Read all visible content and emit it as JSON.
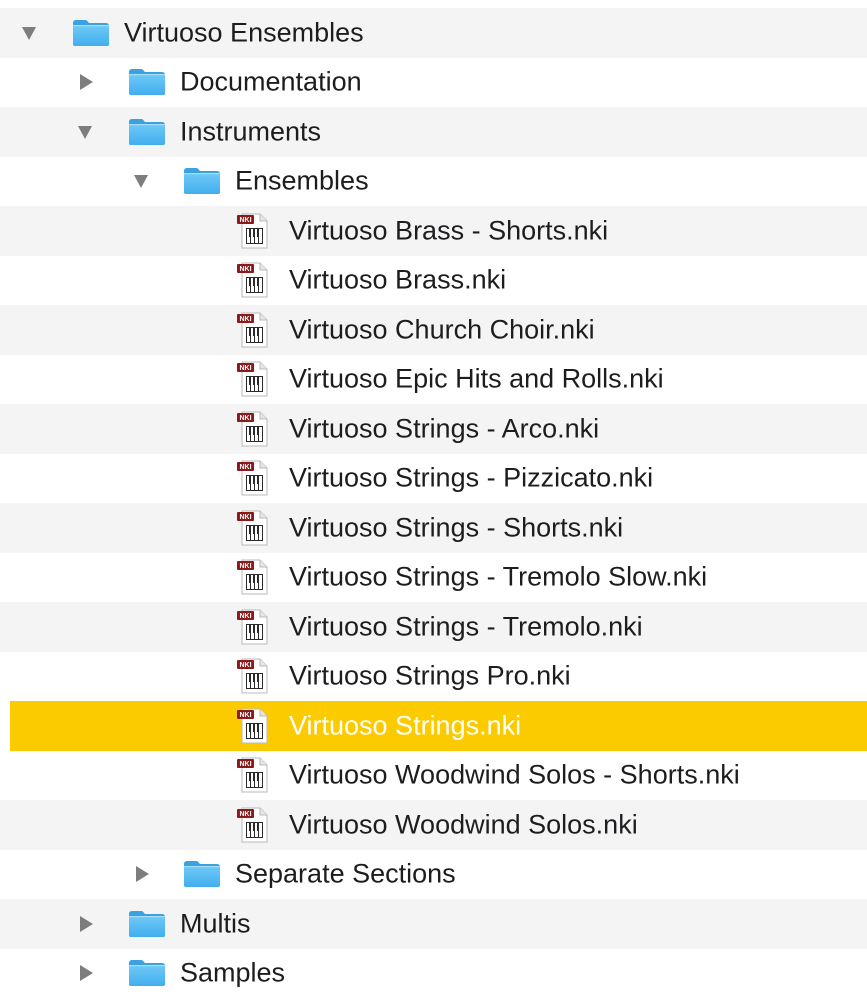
{
  "tree": {
    "root": {
      "label": "Virtuoso Ensembles",
      "icon": "folder-icon",
      "expanded": true
    },
    "documentation": {
      "label": "Documentation",
      "icon": "folder-icon",
      "expanded": false
    },
    "instruments": {
      "label": "Instruments",
      "icon": "folder-icon",
      "expanded": true
    },
    "ensembles": {
      "label": "Ensembles",
      "icon": "folder-icon",
      "expanded": true
    },
    "files": [
      {
        "label": "Virtuoso Brass - Shorts.nki",
        "icon": "nki-file-icon",
        "badge": "NKI"
      },
      {
        "label": "Virtuoso Brass.nki",
        "icon": "nki-file-icon",
        "badge": "NKI"
      },
      {
        "label": "Virtuoso Church Choir.nki",
        "icon": "nki-file-icon",
        "badge": "NKI"
      },
      {
        "label": "Virtuoso Epic Hits and Rolls.nki",
        "icon": "nki-file-icon",
        "badge": "NKI"
      },
      {
        "label": "Virtuoso Strings - Arco.nki",
        "icon": "nki-file-icon",
        "badge": "NKI"
      },
      {
        "label": "Virtuoso Strings - Pizzicato.nki",
        "icon": "nki-file-icon",
        "badge": "NKI"
      },
      {
        "label": "Virtuoso Strings - Shorts.nki",
        "icon": "nki-file-icon",
        "badge": "NKI"
      },
      {
        "label": "Virtuoso Strings - Tremolo Slow.nki",
        "icon": "nki-file-icon",
        "badge": "NKI"
      },
      {
        "label": "Virtuoso Strings - Tremolo.nki",
        "icon": "nki-file-icon",
        "badge": "NKI"
      },
      {
        "label": "Virtuoso Strings Pro.nki",
        "icon": "nki-file-icon",
        "badge": "NKI"
      },
      {
        "label": "Virtuoso Strings.nki",
        "icon": "nki-file-icon",
        "badge": "NKI",
        "selected": true
      },
      {
        "label": "Virtuoso Woodwind Solos - Shorts.nki",
        "icon": "nki-file-icon",
        "badge": "NKI"
      },
      {
        "label": "Virtuoso Woodwind Solos.nki",
        "icon": "nki-file-icon",
        "badge": "NKI"
      }
    ],
    "separate_sections": {
      "label": "Separate Sections",
      "icon": "folder-icon",
      "expanded": false
    },
    "multis": {
      "label": "Multis",
      "icon": "folder-icon",
      "expanded": false
    },
    "samples": {
      "label": "Samples",
      "icon": "folder-icon",
      "expanded": false
    }
  },
  "colors": {
    "selection": "#fbcb00",
    "alt_row": "#f4f4f5",
    "folder": "#5ebef3",
    "disclosure": "#7d7d80"
  }
}
